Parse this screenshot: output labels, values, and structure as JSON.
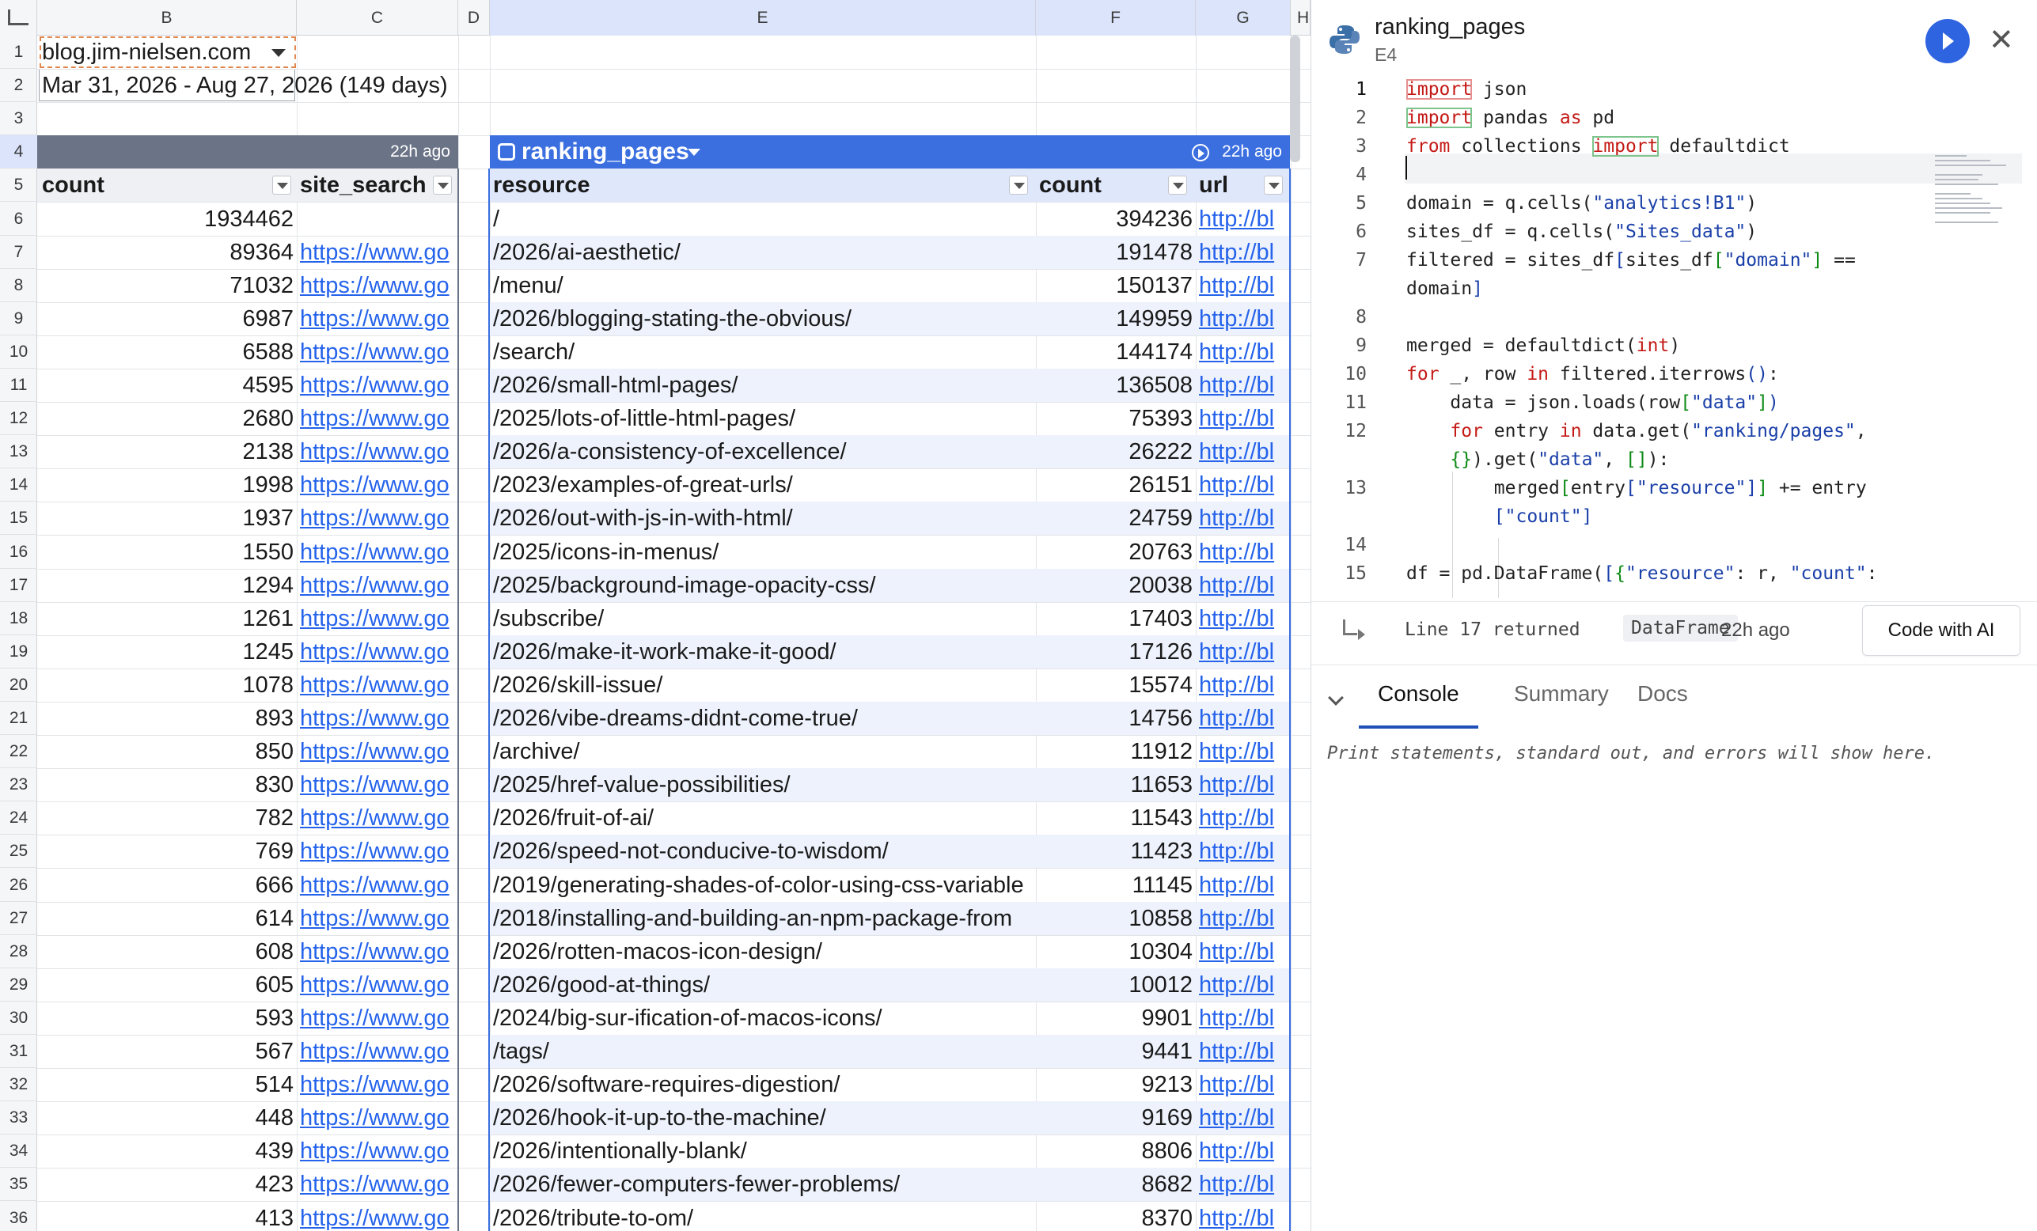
{
  "sheet": {
    "columns": [
      "B",
      "C",
      "D",
      "E",
      "F",
      "G",
      "H"
    ],
    "selected_column": "E",
    "selected_row": "4",
    "rows": [
      "1",
      "2",
      "3",
      "4",
      "5",
      "6",
      "7",
      "8",
      "9",
      "10",
      "11",
      "12",
      "13",
      "14",
      "15",
      "16",
      "17",
      "18",
      "19",
      "20",
      "21",
      "22",
      "23",
      "24",
      "25",
      "26",
      "27",
      "28",
      "29",
      "30",
      "31",
      "32",
      "33",
      "34",
      "35",
      "36"
    ],
    "b1": "blog.jim-nielsen.com",
    "b2": "Mar 31, 2026 - Aug 27, 2026 (149 days)",
    "table1": {
      "updated": "22h ago",
      "headers": [
        "count",
        "site_search"
      ],
      "counts": [
        "1934462",
        "89364",
        "71032",
        "6987",
        "6588",
        "4595",
        "2680",
        "2138",
        "1998",
        "1937",
        "1550",
        "1294",
        "1261",
        "1245",
        "1078",
        "893",
        "850",
        "830",
        "782",
        "769",
        "666",
        "614",
        "608",
        "605",
        "593",
        "567",
        "514",
        "448",
        "439",
        "423",
        "413"
      ],
      "link_text": "https://www.go"
    },
    "table2": {
      "name": "ranking_pages",
      "updated": "22h ago",
      "headers": [
        "resource",
        "count",
        "url"
      ],
      "link_text": "http://bl",
      "resources": [
        "/",
        "/2026/ai-aesthetic/",
        "/menu/",
        "/2026/blogging-stating-the-obvious/",
        "/search/",
        "/2026/small-html-pages/",
        "/2025/lots-of-little-html-pages/",
        "/2026/a-consistency-of-excellence/",
        "/2023/examples-of-great-urls/",
        "/2026/out-with-js-in-with-html/",
        "/2025/icons-in-menus/",
        "/2025/background-image-opacity-css/",
        "/subscribe/",
        "/2026/make-it-work-make-it-good/",
        "/2026/skill-issue/",
        "/2026/vibe-dreams-didnt-come-true/",
        "/archive/",
        "/2025/href-value-possibilities/",
        "/2026/fruit-of-ai/",
        "/2026/speed-not-conducive-to-wisdom/",
        "/2019/generating-shades-of-color-using-css-variable",
        "/2018/installing-and-building-an-npm-package-from",
        "/2026/rotten-macos-icon-design/",
        "/2026/good-at-things/",
        "/2024/big-sur-ification-of-macos-icons/",
        "/tags/",
        "/2026/software-requires-digestion/",
        "/2026/hook-it-up-to-the-machine/",
        "/2026/intentionally-blank/",
        "/2026/fewer-computers-fewer-problems/",
        "/2026/tribute-to-om/"
      ],
      "counts": [
        "394236",
        "191478",
        "150137",
        "149959",
        "144174",
        "136508",
        "75393",
        "26222",
        "26151",
        "24759",
        "20763",
        "20038",
        "17403",
        "17126",
        "15574",
        "14756",
        "11912",
        "11653",
        "11543",
        "11423",
        "11145",
        "10858",
        "10304",
        "10012",
        "9901",
        "9441",
        "9213",
        "9169",
        "8806",
        "8682",
        "8370"
      ]
    }
  },
  "panel": {
    "title": "ranking_pages",
    "cell_ref": "E4",
    "line_numbers": [
      "1",
      "2",
      "3",
      "4",
      "5",
      "6",
      "7",
      "",
      "8",
      "9",
      "10",
      "11",
      "12",
      "",
      "13",
      "",
      "14",
      "15"
    ],
    "return": {
      "text": "Line 17 returned",
      "type": "DataFrame",
      "time": "22h ago"
    },
    "ai_button": "Code with AI",
    "tabs": [
      "Console",
      "Summary",
      "Docs"
    ],
    "console_message": "Print statements, standard out, and errors will show here."
  },
  "colors": {
    "accent": "#2f64e0",
    "table_header_blue": "#3b6fe0",
    "table_header_gray": "#6b7486",
    "link": "#2563eb"
  },
  "icons": [
    "python-icon",
    "play-icon",
    "close-icon",
    "filter-icon",
    "chevron-down-icon",
    "return-arrow-icon"
  ]
}
